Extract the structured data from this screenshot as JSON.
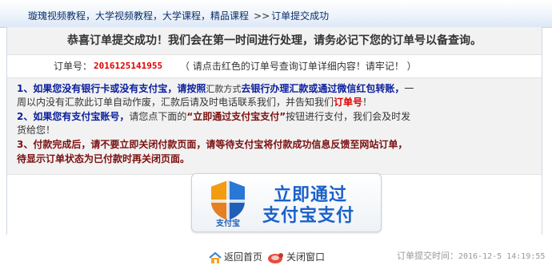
{
  "breadcrumb": {
    "site_title": "璇瑰视频教程，大学视频教程，大学课程，精品课程",
    "separator": ">>",
    "current": "订单提交成功"
  },
  "headline": "恭喜订单提交成功！我们会在第一时间进行处理，请务必记下您的订单号以备查询。",
  "order": {
    "label": "订单号：",
    "number": "2016125141955",
    "hint": "（ 请点击红色的订单号查询订单详细内容！请牢记！ ）"
  },
  "notes": {
    "line1_a": "1、如果您没有银行卡或没有支付宝，请按照",
    "line1_b": "汇款方式",
    "line1_c": "去银行办理汇款或通过微信红包转账，",
    "line1_d": "一",
    "line2_a": "周以内没有汇款此订单自动作废，汇款后请及时电话联系我们，并告知我们",
    "line2_b": "订单号",
    "line2_c": "！",
    "line3_a": "2、如果您有支付宝账号，",
    "line3_b": "请您点下面的",
    "line3_c": "“立即通过支付宝支付”",
    "line3_d": "按钮进行支付，我们会及时发",
    "line4": "货给您！",
    "line5": "3、付款完成后，请不要立即关闭付款页面，请等待支付宝将付款成功信息反馈至网站订单，",
    "line6": "待显示订单状态为已付款时再关闭页面。"
  },
  "alipay_button": {
    "line1": "立即通过",
    "line2": "支付宝支付",
    "logo_text": "支付宝"
  },
  "footer": {
    "home_label": "返回首页",
    "close_label": "关闭窗口",
    "submit_time_label": "订单提交时间：",
    "submit_time_value": "2016-12-5 14:19:55"
  },
  "colors": {
    "blue_text": "#0b1f9c",
    "red_text": "#c00000",
    "alipay_blue": "#1a61c9"
  },
  "icons": {
    "home": "home-icon",
    "close": "close-window-icon",
    "alipay": "alipay-shield-logo"
  }
}
